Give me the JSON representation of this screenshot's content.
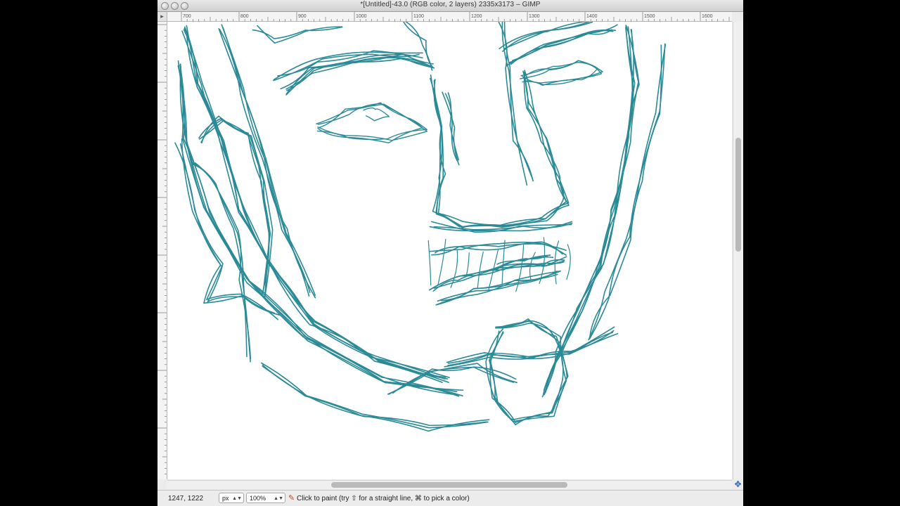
{
  "window": {
    "title": "*[Untitled]-43.0 (RGB color, 2 layers) 2335x3173 – GIMP"
  },
  "rulers": {
    "horizontal_labels": [
      "700",
      "800",
      "900",
      "1000",
      "1100",
      "1200",
      "1300",
      "1400",
      "1500",
      "1600"
    ]
  },
  "canvas": {
    "stroke_color": "#2a8a96",
    "background": "#ffffff",
    "content": "sketch-face"
  },
  "statusbar": {
    "coords": "1247, 1222",
    "unit": "px",
    "zoom": "100%",
    "hint": "Click to paint (try ⇧ for a straight line, ⌘ to pick a color)"
  },
  "icons": {
    "nav": "navigate-icon",
    "tool": "pencil-icon",
    "menu": "ruler-menu-icon"
  }
}
